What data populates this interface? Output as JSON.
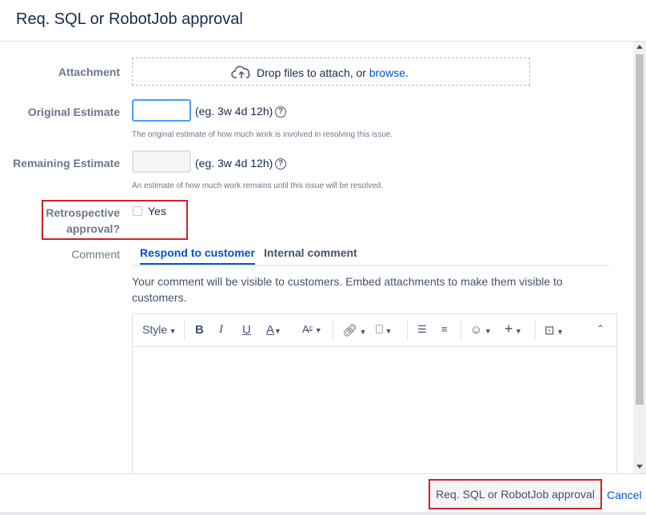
{
  "dialog": {
    "title": "Req. SQL or RobotJob approval"
  },
  "attachment": {
    "label": "Attachment",
    "drop_text": "Drop files to attach, or ",
    "browse_link": "browse",
    "period": "."
  },
  "original_estimate": {
    "label": "Original Estimate",
    "value": "",
    "hint": "(eg. 3w 4d 12h)",
    "description": "The original estimate of how much work is involved in resolving this issue."
  },
  "remaining_estimate": {
    "label": "Remaining Estimate",
    "value": "",
    "hint": "(eg. 3w 4d 12h)",
    "description": "An estimate of how much work remains until this issue will be resolved."
  },
  "retrospective": {
    "label_line1": "Retrospective",
    "label_line2": "approval?",
    "checkbox_label": "Yes",
    "checked": false
  },
  "comment": {
    "label": "Comment",
    "tabs": [
      "Respond to customer",
      "Internal comment"
    ],
    "active_tab": 0,
    "note": "Your comment will be visible to customers. Embed attachments to make them visible to customers.",
    "toolbar": {
      "style_label": "Style"
    }
  },
  "footer": {
    "submit_label": "Req. SQL or RobotJob approval",
    "cancel_label": "Cancel"
  },
  "colors": {
    "accent": "#0052cc",
    "highlight": "#d0202a"
  },
  "icons": [
    "cloud-upload-icon",
    "help-icon",
    "bold-icon",
    "italic-icon",
    "underline-icon",
    "text-color-icon",
    "text-format-icon",
    "link-icon",
    "attachment-icon",
    "bullet-list-icon",
    "numbered-list-icon",
    "emoji-icon",
    "insert-icon",
    "comment-macro-icon",
    "collapse-icon"
  ]
}
